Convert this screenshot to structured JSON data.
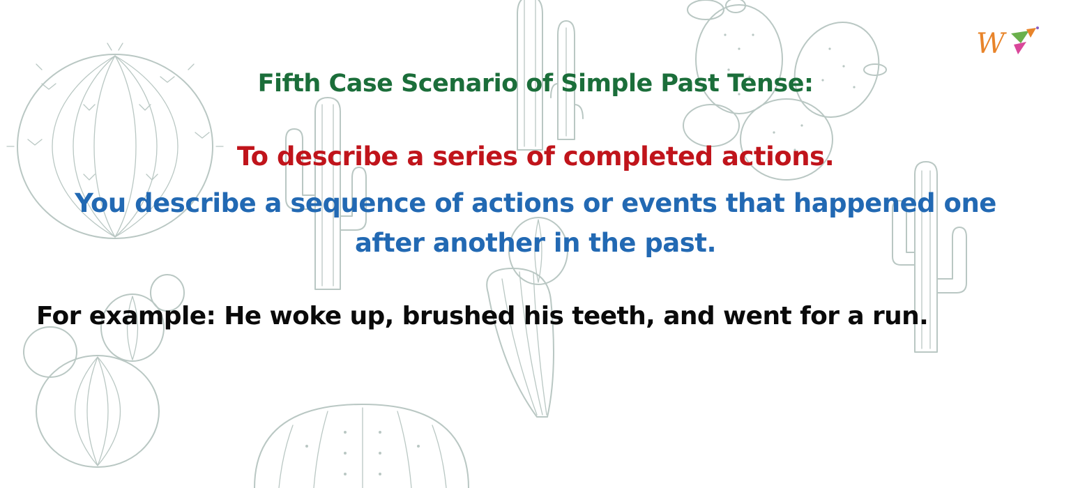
{
  "slide": {
    "title": "Fifth Case Scenario of Simple Past Tense:",
    "subtitle": "To describe a series of completed actions.",
    "description": "You describe a sequence of actions or events that happened one after another in the past.",
    "example": "For example: He woke up, brushed his teeth, and went for a run."
  },
  "logo": {
    "icon": "w-brand-logo-icon",
    "letter": "W"
  },
  "colors": {
    "title": "#1b6e3a",
    "subtitle": "#c0141b",
    "description": "#2269b3",
    "example": "#0a0a0a",
    "background_art": "#b9c7c3",
    "logo_orange": "#e8842a",
    "logo_pink": "#d9479a",
    "logo_green": "#6ab04c"
  },
  "background": {
    "icon": "cactus-pattern-illustration"
  }
}
